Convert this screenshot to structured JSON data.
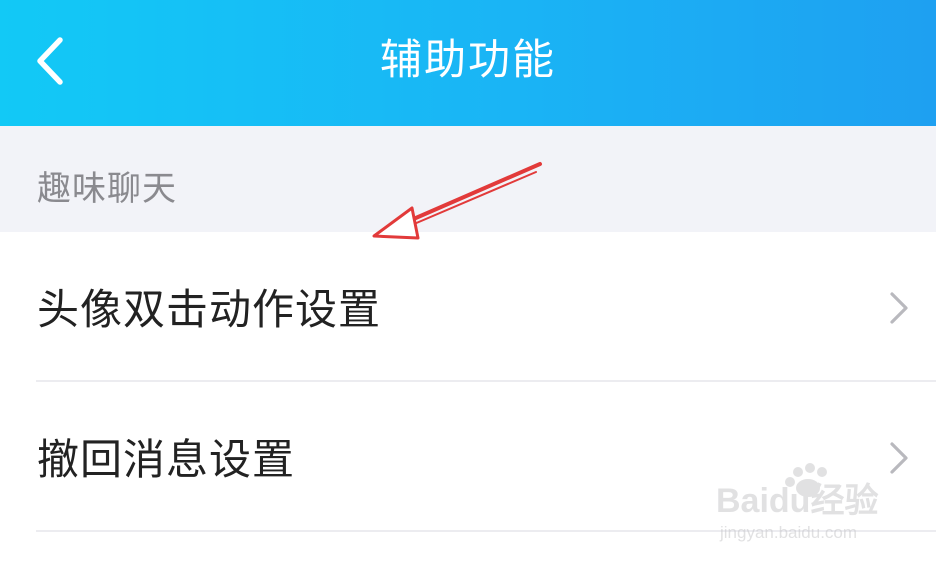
{
  "header": {
    "title": "辅助功能",
    "background_start": "#12c9f6",
    "background_end": "#1ea0f1",
    "back_icon": "chevron-left-icon"
  },
  "section": {
    "label": "趣味聊天"
  },
  "items": [
    {
      "label": "头像双击动作设置",
      "icon": "chevron-right-icon"
    },
    {
      "label": "撤回消息设置",
      "icon": "chevron-right-icon"
    }
  ],
  "annotation": {
    "color": "#e23a3a",
    "icon": "red-arrow-icon"
  },
  "watermark": {
    "brand": "Baidu经验",
    "site": "jingyan.baidu.com"
  }
}
